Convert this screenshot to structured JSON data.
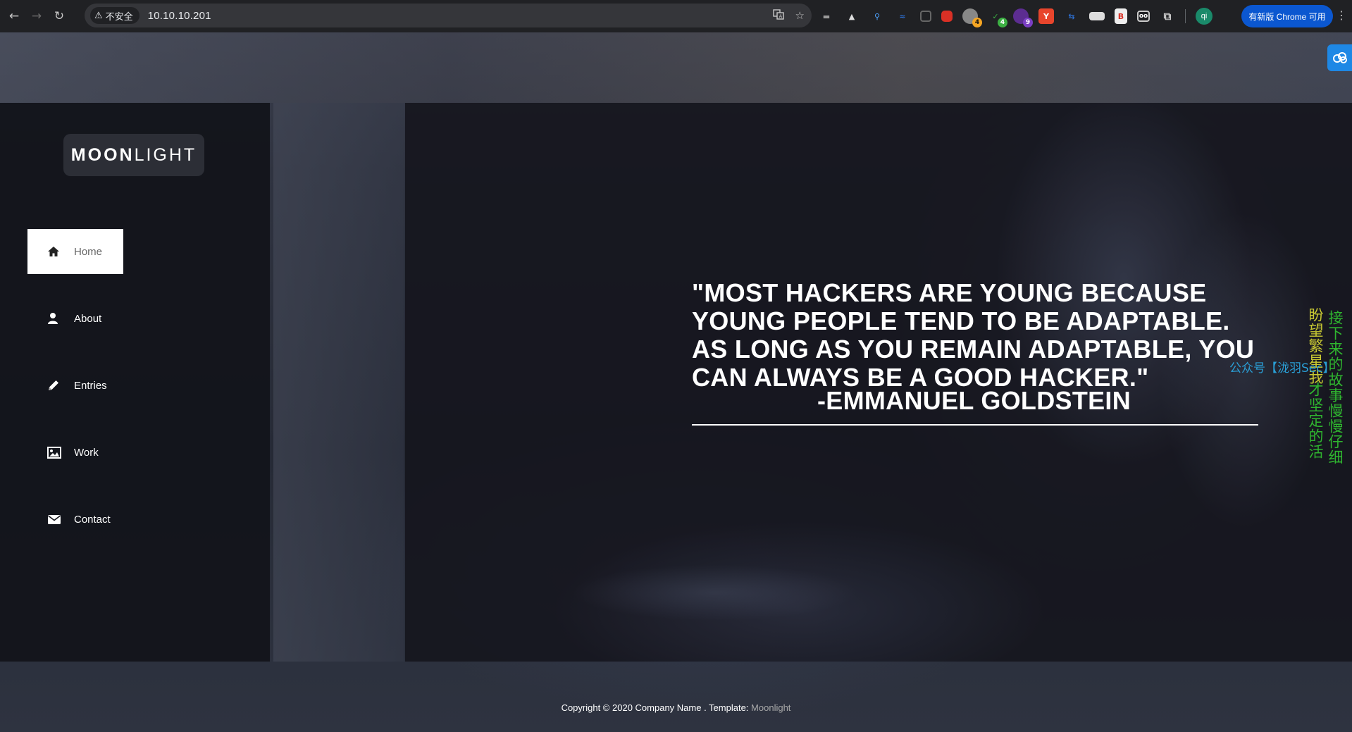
{
  "browser": {
    "security_label": "不安全",
    "url": "10.10.10.201",
    "update_button": "有新版 Chrome 可用",
    "profile_initials": "qi",
    "extension_badges": [
      "4",
      "4",
      "9"
    ]
  },
  "site": {
    "logo_bold": "MOON",
    "logo_light": "LIGHT",
    "nav": [
      {
        "label": "Home",
        "icon": "home-icon",
        "active": true
      },
      {
        "label": "About",
        "icon": "user-icon",
        "active": false
      },
      {
        "label": "Entries",
        "icon": "pencil-icon",
        "active": false
      },
      {
        "label": "Work",
        "icon": "image-icon",
        "active": false
      },
      {
        "label": "Contact",
        "icon": "envelope-icon",
        "active": false
      }
    ],
    "quote": "\"MOST HACKERS ARE YOUNG BECAUSE YOUNG PEOPLE TEND TO BE ADAPTABLE. AS LONG AS YOU REMAIN ADAPTABLE, YOU CAN ALWAYS BE A GOOD HACKER.\"",
    "quote_author": "-EMMANUEL GOLDSTEIN",
    "footer_text": "Copyright © 2020 Company Name . Template: ",
    "footer_link": "Moonlight"
  },
  "overlay": {
    "col_right": "接下来的故事慢慢仔细",
    "col_left_top": "盼望繁星我",
    "col_left_bottom": "才坚定的活",
    "watermark": "公众号【泷羽Sec】"
  },
  "colors": {
    "browser_bar": "#202124",
    "omnibox": "#35363a",
    "sidebar": "#12131a",
    "active_nav": "#ffffff",
    "update_button": "#0b57d0",
    "overlay_green": "#2fb52f",
    "overlay_yellow": "#c8c832",
    "overlay_blue": "#2a9fd6"
  }
}
